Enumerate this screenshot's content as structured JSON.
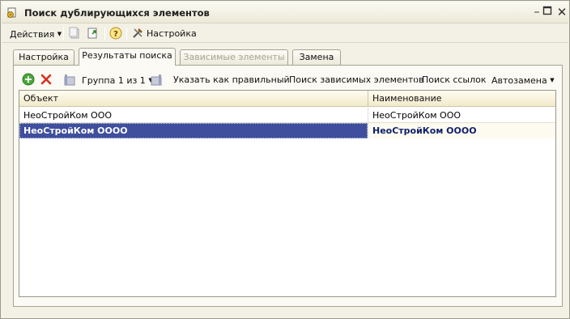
{
  "window": {
    "title": "Поиск дублирующихся элементов"
  },
  "menubar": {
    "actions_label": "Действия",
    "settings_label": "Настройка"
  },
  "tabs": [
    {
      "label": "Настройка"
    },
    {
      "label": "Результаты поиска"
    },
    {
      "label": "Зависимые элементы"
    },
    {
      "label": "Замена"
    }
  ],
  "toolbar": {
    "group_label": "Группа 1 из 1",
    "mark_correct_label": "Указать как правильный",
    "find_dependent_label": "Поиск зависимых элементов",
    "find_refs_label": "Поиск ссылок",
    "autoreplace_label": "Автозамена"
  },
  "table": {
    "columns": [
      "Объект",
      "Наименование"
    ],
    "rows": [
      {
        "object": "НеоСтройКом ООО",
        "name": "НеоСтройКом ООО"
      },
      {
        "object": "НеоСтройКом ОООО",
        "name": "НеоСтройКом ОООО"
      }
    ],
    "selected_row": 1
  },
  "colors": {
    "selection": "#3f4f9e",
    "window_bg": "#f3f1e6",
    "header_bg": "#f1eacb"
  }
}
